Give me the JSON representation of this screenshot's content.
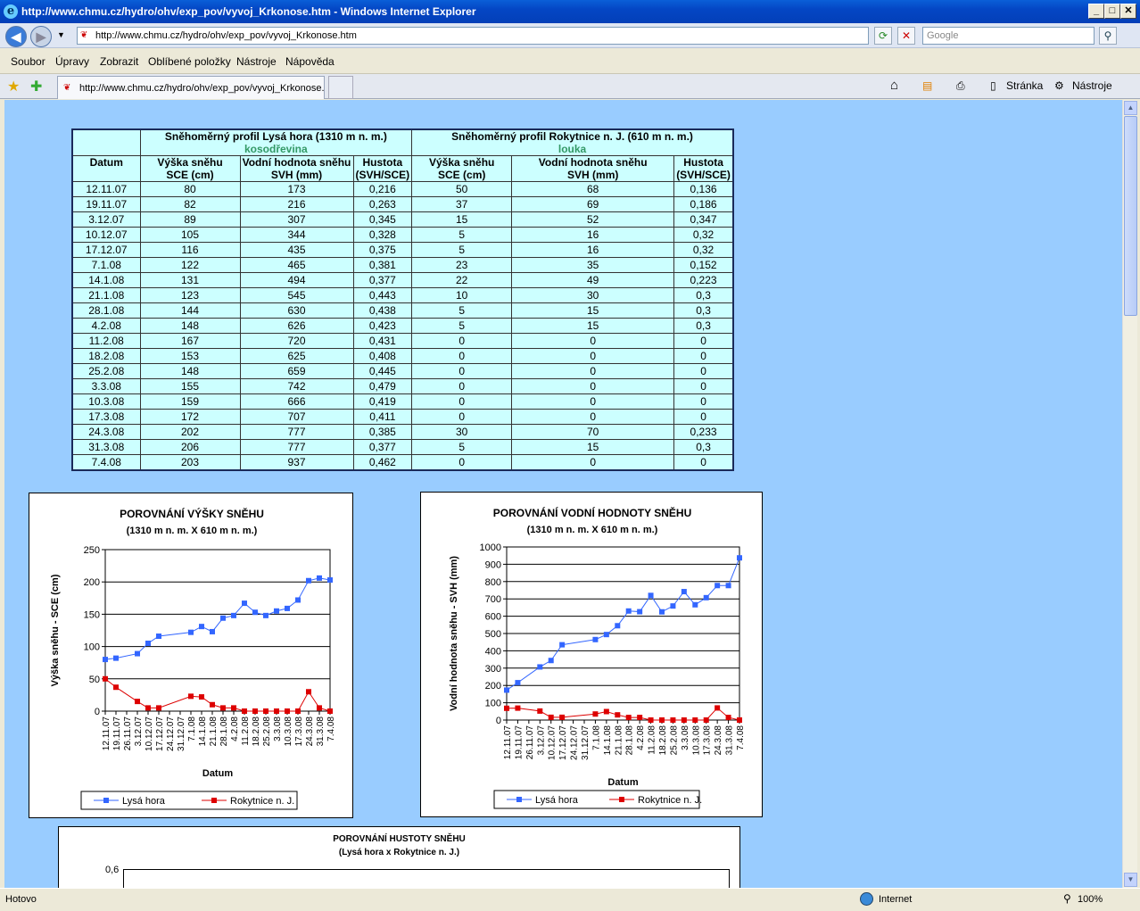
{
  "window": {
    "title": "http://www.chmu.cz/hydro/ohv/exp_pov/vyvoj_Krkonose.htm - Windows Internet Explorer"
  },
  "address": {
    "url": "http://www.chmu.cz/hydro/ohv/exp_pov/vyvoj_Krkonose.htm",
    "search_placeholder": "Google"
  },
  "menu": [
    "Soubor",
    "Úpravy",
    "Zobrazit",
    "Oblíbené položky",
    "Nástroje",
    "Nápověda"
  ],
  "tab": {
    "label": "http://www.chmu.cz/hydro/ohv/exp_pov/vyvoj_Krkonose.htm"
  },
  "toolbar": {
    "page_label": "Stránka",
    "tools_label": "Nástroje"
  },
  "status": {
    "left": "Hotovo",
    "zone": "Internet",
    "zoom": "100%"
  },
  "table": {
    "date_header": "Datum",
    "profile1": {
      "title": "Sněhoměrný profil Lysá hora (1310 m n. m.)",
      "sub": "kosodřevina"
    },
    "profile2": {
      "title": "Sněhoměrný profil Rokytnice n. J. (610 m n. m.)",
      "sub": "louka"
    },
    "col_sce": [
      "Výška sněhu",
      "SCE (cm)"
    ],
    "col_svh": [
      "Vodní hodnota sněhu",
      "SVH (mm)"
    ],
    "col_hus": [
      "Hustota",
      "(SVH/SCE)"
    ],
    "rows": [
      [
        "12.11.07",
        "80",
        "173",
        "0,216",
        "50",
        "68",
        "0,136"
      ],
      [
        "19.11.07",
        "82",
        "216",
        "0,263",
        "37",
        "69",
        "0,186"
      ],
      [
        "3.12.07",
        "89",
        "307",
        "0,345",
        "15",
        "52",
        "0,347"
      ],
      [
        "10.12.07",
        "105",
        "344",
        "0,328",
        "5",
        "16",
        "0,32"
      ],
      [
        "17.12.07",
        "116",
        "435",
        "0,375",
        "5",
        "16",
        "0,32"
      ],
      [
        "7.1.08",
        "122",
        "465",
        "0,381",
        "23",
        "35",
        "0,152"
      ],
      [
        "14.1.08",
        "131",
        "494",
        "0,377",
        "22",
        "49",
        "0,223"
      ],
      [
        "21.1.08",
        "123",
        "545",
        "0,443",
        "10",
        "30",
        "0,3"
      ],
      [
        "28.1.08",
        "144",
        "630",
        "0,438",
        "5",
        "15",
        "0,3"
      ],
      [
        "4.2.08",
        "148",
        "626",
        "0,423",
        "5",
        "15",
        "0,3"
      ],
      [
        "11.2.08",
        "167",
        "720",
        "0,431",
        "0",
        "0",
        "0"
      ],
      [
        "18.2.08",
        "153",
        "625",
        "0,408",
        "0",
        "0",
        "0"
      ],
      [
        "25.2.08",
        "148",
        "659",
        "0,445",
        "0",
        "0",
        "0"
      ],
      [
        "3.3.08",
        "155",
        "742",
        "0,479",
        "0",
        "0",
        "0"
      ],
      [
        "10.3.08",
        "159",
        "666",
        "0,419",
        "0",
        "0",
        "0"
      ],
      [
        "17.3.08",
        "172",
        "707",
        "0,411",
        "0",
        "0",
        "0"
      ],
      [
        "24.3.08",
        "202",
        "777",
        "0,385",
        "30",
        "70",
        "0,233"
      ],
      [
        "31.3.08",
        "206",
        "777",
        "0,377",
        "5",
        "15",
        "0,3"
      ],
      [
        "7.4.08",
        "203",
        "937",
        "0,462",
        "0",
        "0",
        "0"
      ]
    ]
  },
  "chart_data": [
    {
      "type": "line",
      "title": "POROVNÁNÍ VÝŠKY SNĚHU",
      "subtitle": "(1310 m n. m. X 610 m n. m.)",
      "xlabel": "Datum",
      "ylabel": "Výška sněhu - SCE (cm)",
      "ylim": [
        0,
        250
      ],
      "yticks": [
        0,
        50,
        100,
        150,
        200,
        250
      ],
      "categories": [
        "12.11.07",
        "19.11.07",
        "26.11.07",
        "3.12.07",
        "10.12.07",
        "17.12.07",
        "24.12.07",
        "31.12.07",
        "7.1.08",
        "14.1.08",
        "21.1.08",
        "28.1.08",
        "4.2.08",
        "11.2.08",
        "18.2.08",
        "25.2.08",
        "3.3.08",
        "10.3.08",
        "17.3.08",
        "24.3.08",
        "31.3.08",
        "7.4.08"
      ],
      "series": [
        {
          "name": "Lysá hora",
          "color": "#3366ff",
          "values": [
            80,
            82,
            null,
            89,
            105,
            116,
            null,
            null,
            122,
            131,
            123,
            144,
            148,
            167,
            153,
            148,
            155,
            159,
            172,
            202,
            206,
            203
          ]
        },
        {
          "name": "Rokytnice n. J.",
          "color": "#dd0000",
          "values": [
            50,
            37,
            null,
            15,
            5,
            5,
            null,
            null,
            23,
            22,
            10,
            5,
            5,
            0,
            0,
            0,
            0,
            0,
            0,
            30,
            5,
            0
          ]
        }
      ],
      "legend": "bottom",
      "grid": true
    },
    {
      "type": "line",
      "title": "POROVNÁNÍ VODNÍ HODNOTY SNĚHU",
      "subtitle": "(1310 m n. m. X 610 m n. m.)",
      "xlabel": "Datum",
      "ylabel": "Vodní hodnota sněhu - SVH (mm)",
      "ylim": [
        0,
        1000
      ],
      "yticks": [
        0,
        100,
        200,
        300,
        400,
        500,
        600,
        700,
        800,
        900,
        1000
      ],
      "categories": [
        "12.11.07",
        "19.11.07",
        "26.11.07",
        "3.12.07",
        "10.12.07",
        "17.12.07",
        "24.12.07",
        "31.12.07",
        "7.1.08",
        "14.1.08",
        "21.1.08",
        "28.1.08",
        "4.2.08",
        "11.2.08",
        "18.2.08",
        "25.2.08",
        "3.3.08",
        "10.3.08",
        "17.3.08",
        "24.3.08",
        "31.3.08",
        "7.4.08"
      ],
      "series": [
        {
          "name": "Lysá hora",
          "color": "#3366ff",
          "values": [
            173,
            216,
            null,
            307,
            344,
            435,
            null,
            null,
            465,
            494,
            545,
            630,
            626,
            720,
            625,
            659,
            742,
            666,
            707,
            777,
            777,
            937
          ]
        },
        {
          "name": "Rokytnice n. J.",
          "color": "#dd0000",
          "values": [
            68,
            69,
            null,
            52,
            16,
            16,
            null,
            null,
            35,
            49,
            30,
            15,
            15,
            0,
            0,
            0,
            0,
            0,
            0,
            70,
            15,
            0
          ]
        }
      ],
      "legend": "bottom",
      "grid": true
    },
    {
      "type": "line",
      "title": "POROVNÁNÍ HUSTOTY SNĚHU",
      "subtitle": "(Lysá hora x Rokytnice n. J.)",
      "yticks_visible": [
        "0,6"
      ]
    }
  ]
}
